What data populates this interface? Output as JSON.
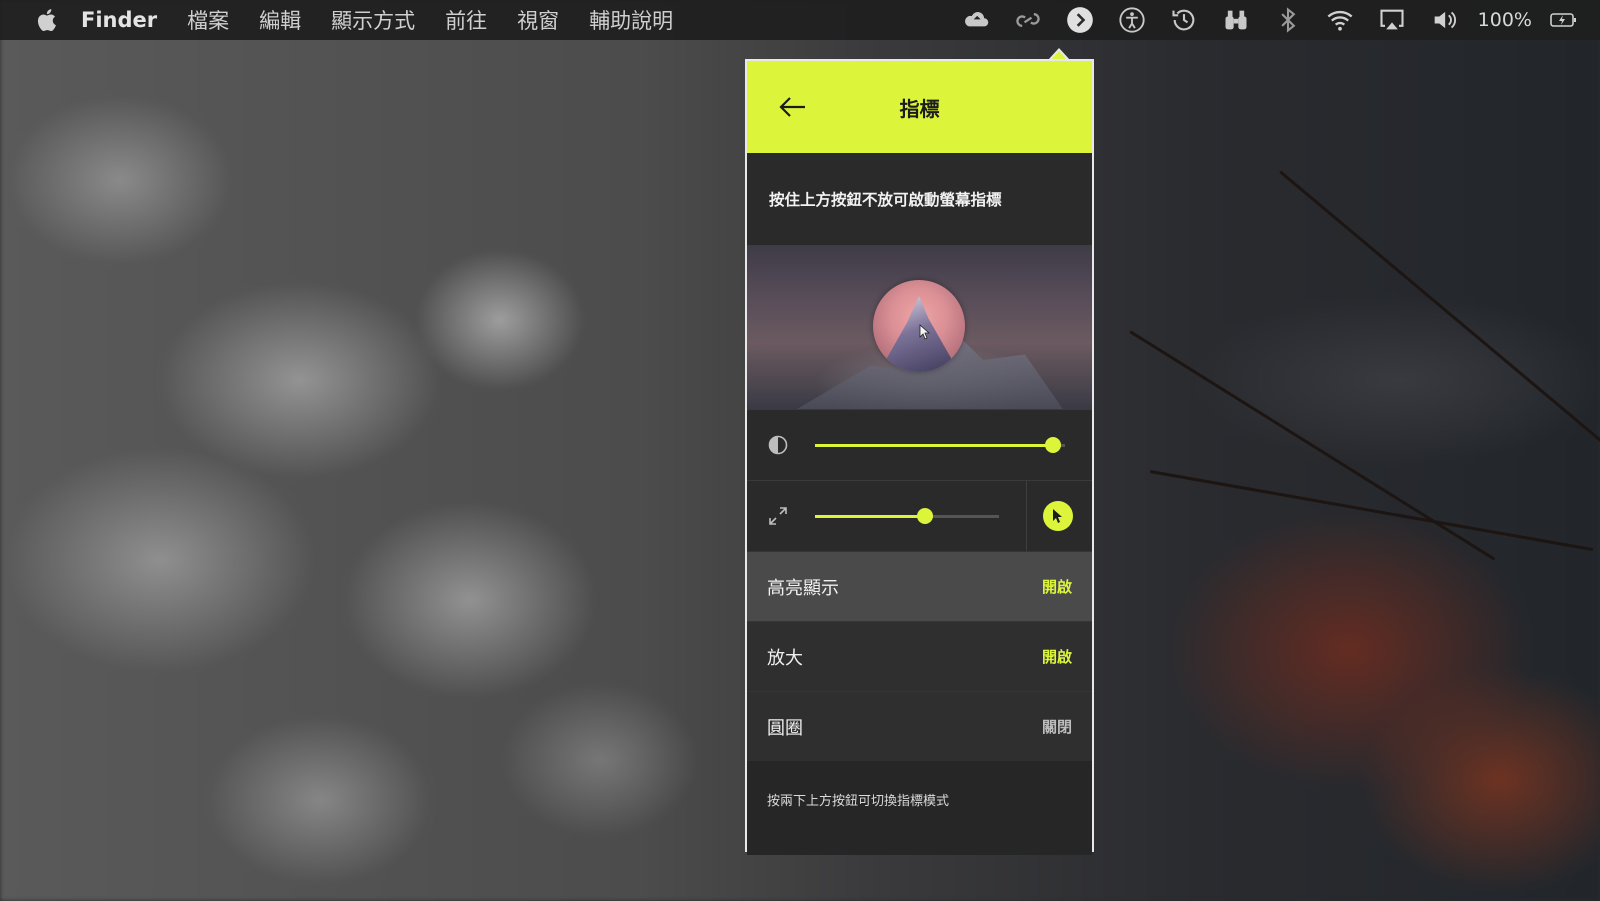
{
  "menubar": {
    "app_name": "Finder",
    "items": [
      "檔案",
      "編輯",
      "顯示方式",
      "前往",
      "視窗",
      "輔助說明"
    ],
    "battery_percent": "100%",
    "tray_icons": [
      "cloud-upload-icon",
      "creative-cloud-icon",
      "presentation-pointer-icon",
      "accessibility-icon",
      "time-machine-icon",
      "binoculars-icon",
      "bluetooth-icon",
      "wifi-icon",
      "airplay-icon",
      "volume-icon",
      "battery-charging-icon"
    ]
  },
  "panel": {
    "title": "指標",
    "instruction": "按住上方按鈕不放可啟動螢幕指標",
    "sliders": {
      "opacity_level": 1.0,
      "size_level": 0.6
    },
    "options": [
      {
        "label": "高亮顯示",
        "value": "開啟",
        "state": "on"
      },
      {
        "label": "放大",
        "value": "開啟",
        "state": "on"
      },
      {
        "label": "圓圈",
        "value": "關閉",
        "state": "off"
      }
    ],
    "footer": "按兩下上方按鈕可切換指標模式"
  },
  "colors": {
    "accent": "#dcf53a",
    "panel_bg": "#2a2a2a"
  }
}
